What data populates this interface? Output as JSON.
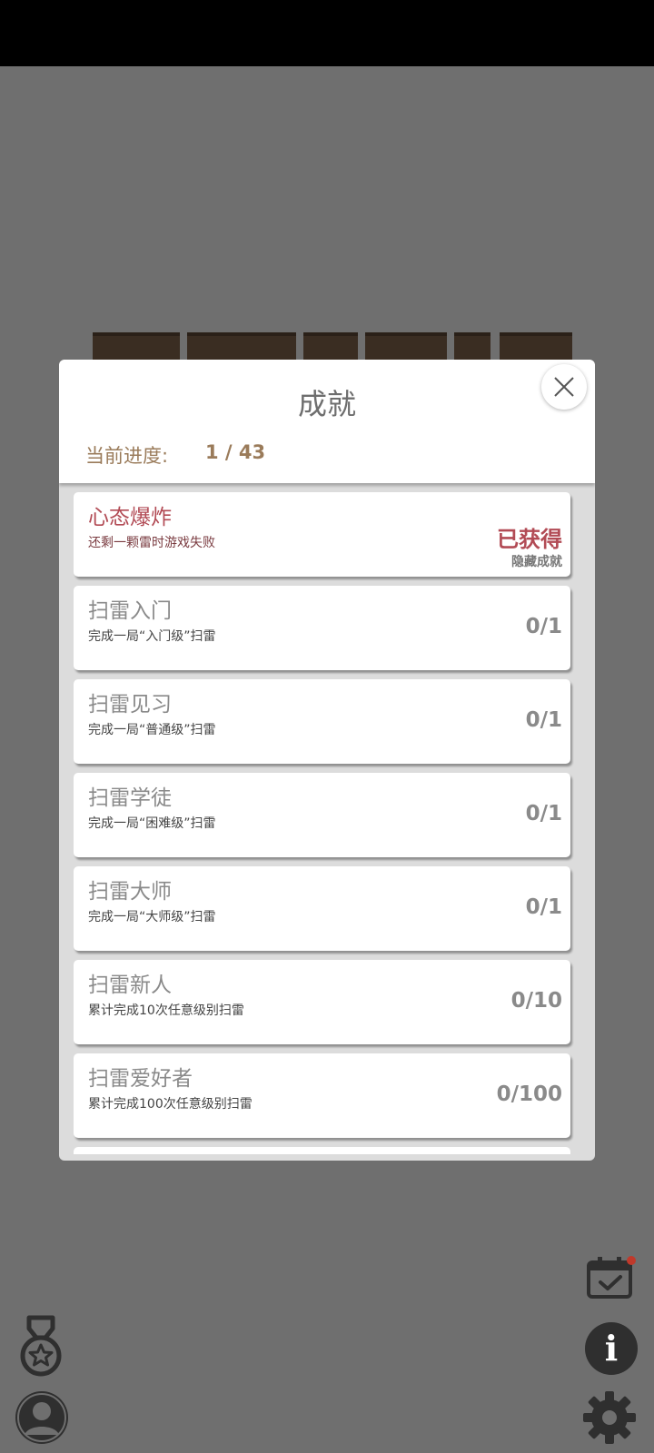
{
  "dialog": {
    "title": "成就",
    "progress_label": "当前进度:",
    "progress_value": "1 / 43",
    "close_icon": "close-icon"
  },
  "achievements": [
    {
      "title": "心态爆炸",
      "desc": "还剩一颗雷时游戏失败",
      "status": "已获得",
      "tag": "隐藏成就"
    },
    {
      "title": "扫雷入门",
      "desc": "完成一局“入门级”扫雷",
      "count": "0/1"
    },
    {
      "title": "扫雷见习",
      "desc": "完成一局“普通级”扫雷",
      "count": "0/1"
    },
    {
      "title": "扫雷学徒",
      "desc": "完成一局“困难级”扫雷",
      "count": "0/1"
    },
    {
      "title": "扫雷大师",
      "desc": "完成一局“大师级”扫雷",
      "count": "0/1"
    },
    {
      "title": "扫雷新人",
      "desc": "累计完成10次任意级别扫雷",
      "count": "0/10"
    },
    {
      "title": "扫雷爱好者",
      "desc": "累计完成100次任意级别扫雷",
      "count": "0/100"
    }
  ],
  "icons": {
    "medal": "medal-icon",
    "profile": "profile-icon",
    "calendar": "calendar-check-icon",
    "info": "info-icon",
    "settings": "gear-icon"
  },
  "colors": {
    "accent_earned": "#b24b55",
    "progress_text": "#9a7b5a",
    "notification_dot": "#c0392b"
  }
}
